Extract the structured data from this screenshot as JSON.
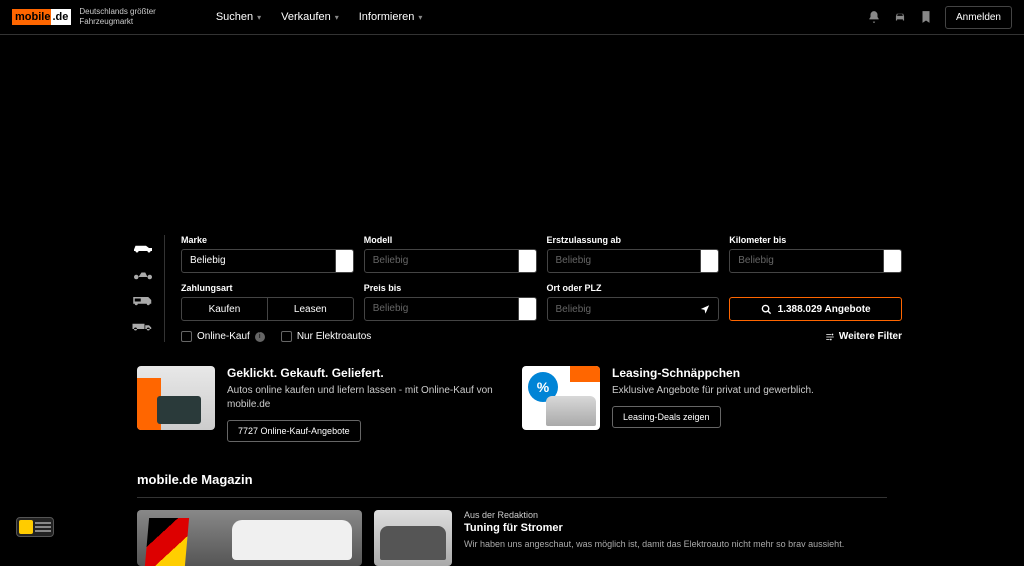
{
  "header": {
    "logo_left": "mobile",
    "logo_right": ".de",
    "tagline_1": "Deutschlands größter",
    "tagline_2": "Fahrzeugmarkt",
    "nav": {
      "search": "Suchen",
      "sell": "Verkaufen",
      "inform": "Informieren"
    },
    "login": "Anmelden"
  },
  "search": {
    "labels": {
      "brand": "Marke",
      "model": "Modell",
      "first_reg": "Erstzulassung ab",
      "km": "Kilometer bis",
      "payment": "Zahlungsart",
      "price": "Preis bis",
      "location": "Ort oder PLZ"
    },
    "values": {
      "brand": "Beliebig"
    },
    "placeholders": {
      "generic": "Beliebig"
    },
    "payment": {
      "buy": "Kaufen",
      "lease": "Leasen"
    },
    "results_btn": "1.388.029 Angebote",
    "checkboxes": {
      "online": "Online-Kauf",
      "electro": "Nur Elektroautos"
    },
    "more_filters": "Weitere Filter"
  },
  "promos": {
    "p1": {
      "title": "Geklickt. Gekauft. Geliefert.",
      "text": "Autos online kaufen und liefern lassen - mit Online-Kauf von mobile.de",
      "btn": "7727 Online-Kauf-Angebote"
    },
    "p2": {
      "title": "Leasing-Schnäppchen",
      "text": "Exklusive Angebote für privat und gewerblich.",
      "btn": "Leasing-Deals zeigen"
    }
  },
  "magazin": {
    "title": "mobile.de Magazin",
    "article": {
      "kicker": "Aus der Redaktion",
      "headline": "Tuning für Stromer",
      "text": "Wir haben uns angeschaut, was möglich ist, damit das Elektroauto nicht mehr so brav aussieht."
    }
  }
}
